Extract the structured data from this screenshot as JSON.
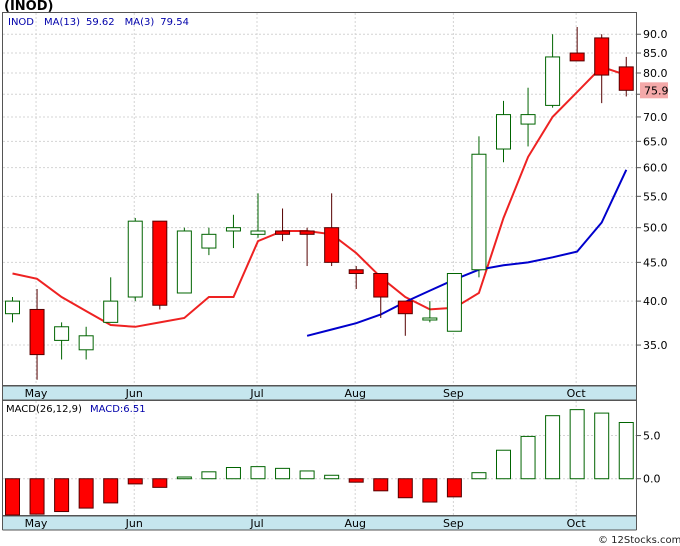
{
  "header": {
    "title": "(INOD)",
    "ticker_label": "INOD",
    "ma13_label": "MA(13)",
    "ma13_value": "59.62",
    "ma3_label": "MA(3)",
    "ma3_value": "79.54"
  },
  "macd_header": {
    "label": "MACD(26,12,9)",
    "value_label": "MACD:6.51"
  },
  "price_badge": "75.9",
  "footer": "© 12Stocks.com",
  "colors": {
    "up": "#006400",
    "down": "#ff0000",
    "ma13": "#0000cc",
    "ma3": "#ee2222",
    "axis_band": "#c6e6ee",
    "badge_bg": "#f4a9a9"
  },
  "chart_data": [
    {
      "type": "candlestick",
      "title": "(INOD)",
      "ylim": [
        31,
        96
      ],
      "y_ticks": [
        "35.0",
        "40.0",
        "45.0",
        "50.0",
        "55.0",
        "60.0",
        "65.0",
        "70.0",
        "75.0",
        "80.0",
        "85.0",
        "90.0"
      ],
      "y_tick_values": [
        35,
        40,
        45,
        50,
        55,
        60,
        65,
        70,
        75,
        80,
        85,
        90
      ],
      "x_month_labels": [
        {
          "label": "May",
          "bar": 1
        },
        {
          "label": "Jun",
          "bar": 5
        },
        {
          "label": "Jul",
          "bar": 10
        },
        {
          "label": "Aug",
          "bar": 14
        },
        {
          "label": "Sep",
          "bar": 18
        },
        {
          "label": "Oct",
          "bar": 23
        }
      ],
      "candles": [
        {
          "o": 38.5,
          "h": 40.5,
          "l": 37.5,
          "c": 40.0
        },
        {
          "o": 39.0,
          "h": 41.5,
          "l": 31.5,
          "c": 34.0
        },
        {
          "o": 35.5,
          "h": 37.5,
          "l": 33.5,
          "c": 37.0
        },
        {
          "o": 34.5,
          "h": 37.0,
          "l": 33.5,
          "c": 36.0
        },
        {
          "o": 37.5,
          "h": 43.0,
          "l": 37.5,
          "c": 40.0
        },
        {
          "o": 40.5,
          "h": 51.5,
          "l": 40.0,
          "c": 51.0
        },
        {
          "o": 51.0,
          "h": 51.0,
          "l": 39.0,
          "c": 39.5
        },
        {
          "o": 41.0,
          "h": 50.0,
          "l": 41.0,
          "c": 49.5
        },
        {
          "o": 47.0,
          "h": 50.0,
          "l": 46.0,
          "c": 49.0
        },
        {
          "o": 49.5,
          "h": 52.0,
          "l": 47.0,
          "c": 50.0
        },
        {
          "o": 49.0,
          "h": 55.5,
          "l": 48.5,
          "c": 49.5
        },
        {
          "o": 49.5,
          "h": 53.0,
          "l": 48.0,
          "c": 49.0
        },
        {
          "o": 49.5,
          "h": 50.0,
          "l": 44.5,
          "c": 49.0
        },
        {
          "o": 50.0,
          "h": 55.5,
          "l": 44.5,
          "c": 45.0
        },
        {
          "o": 44.0,
          "h": 44.5,
          "l": 41.5,
          "c": 43.5
        },
        {
          "o": 43.5,
          "h": 43.5,
          "l": 38.0,
          "c": 40.5
        },
        {
          "o": 40.0,
          "h": 40.0,
          "l": 36.0,
          "c": 38.5
        },
        {
          "o": 38.0,
          "h": 40.0,
          "l": 37.5,
          "c": 38.0
        },
        {
          "o": 36.5,
          "h": 43.5,
          "l": 36.5,
          "c": 43.5
        },
        {
          "o": 44.0,
          "h": 66.0,
          "l": 43.0,
          "c": 62.5
        },
        {
          "o": 63.5,
          "h": 73.5,
          "l": 61.0,
          "c": 70.5
        },
        {
          "o": 68.5,
          "h": 76.5,
          "l": 64.0,
          "c": 70.5
        },
        {
          "o": 72.5,
          "h": 90.0,
          "l": 72.0,
          "c": 84.0
        },
        {
          "o": 85.0,
          "h": 92.0,
          "l": 83.0,
          "c": 83.0
        },
        {
          "o": 89.0,
          "h": 90.0,
          "l": 73.0,
          "c": 79.5
        },
        {
          "o": 81.5,
          "h": 84.0,
          "l": 74.5,
          "c": 75.9
        }
      ],
      "series": [
        {
          "name": "MA(3)",
          "values": [
            43.5,
            42.8,
            40.5,
            38.8,
            37.2,
            37.0,
            37.5,
            38.0,
            40.5,
            40.5,
            48.0,
            49.5,
            49.5,
            49.0,
            46.3,
            43.0,
            40.5,
            39.0,
            39.2,
            41.0,
            51.5,
            62.0,
            70.0,
            75.5,
            81.5,
            79.5
          ]
        },
        {
          "name": "MA(13)",
          "values": [
            null,
            null,
            null,
            null,
            null,
            null,
            null,
            null,
            null,
            null,
            null,
            null,
            36.0,
            36.7,
            37.4,
            38.4,
            39.9,
            41.3,
            42.7,
            44.0,
            44.6,
            45.0,
            45.7,
            46.5,
            50.8,
            59.62
          ]
        }
      ]
    },
    {
      "type": "bar",
      "title": "MACD(26,12,9)",
      "ylim": [
        -4.2,
        9.0
      ],
      "y_ticks": [
        "0.0",
        "5.0"
      ],
      "y_tick_values": [
        0,
        5
      ],
      "values": [
        -4.2,
        -4.1,
        -3.8,
        -3.4,
        -2.8,
        -0.6,
        -1.0,
        0.2,
        0.8,
        1.3,
        1.4,
        1.2,
        0.9,
        0.4,
        -0.4,
        -1.4,
        -2.2,
        -2.7,
        -2.1,
        0.7,
        3.3,
        4.9,
        7.3,
        8.0,
        7.6,
        6.51
      ]
    }
  ]
}
